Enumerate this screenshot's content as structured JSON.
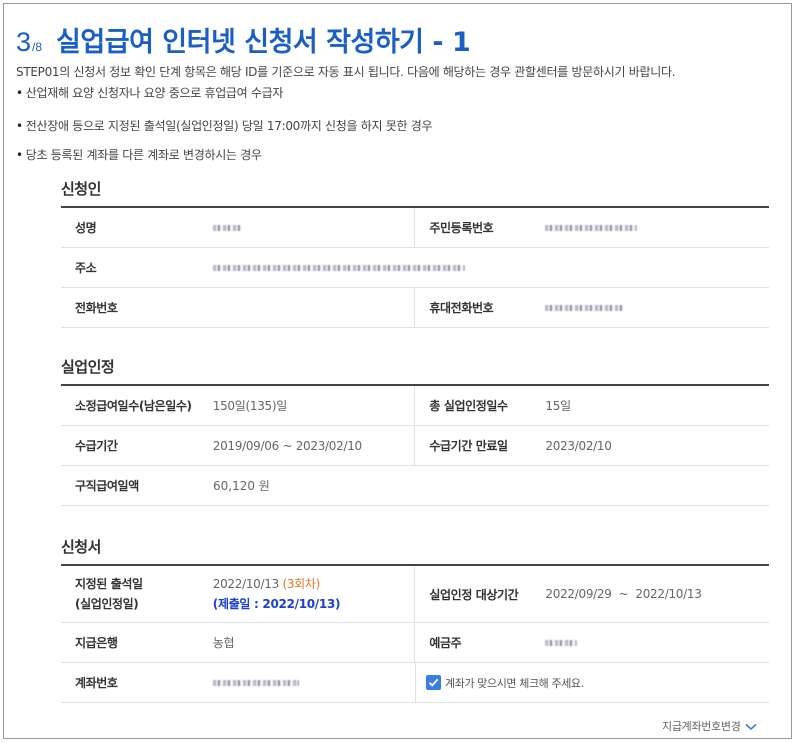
{
  "header": {
    "step_current": "3",
    "step_total": "/8",
    "title": "실업급여 인터넷 신청서 작성하기 - 1"
  },
  "intro": "STEP01의 신청서 정보 확인 단계 항목은 해당 ID를 기준으로 자동 표시 됩니다. 다음에 해당하는 경우 관할센터를 방문하시기 바랍니다.",
  "notes": [
    "산업재해 요양 신청자나 요양 중으로 휴업급여 수급자",
    "전산장애 등으로 지정된 출석일(실업인정일) 당일 17:00까지 신청을 하지 못한 경우",
    "당초 등록된 계좌를 다른 계좌로 변경하시는 경우"
  ],
  "applicant": {
    "section_title": "신청인",
    "name_label": "성명",
    "rrn_label": "주민등록번호",
    "address_label": "주소",
    "phone_label": "전화번호",
    "phone_value": "",
    "mobile_label": "휴대전화번호"
  },
  "unemployment": {
    "section_title": "실업인정",
    "days_label": "소정급여일수(남은일수)",
    "days_value": "150일(135)일",
    "total_days_label": "총 실업인정일수",
    "total_days_value": "15일",
    "period_label": "수급기간",
    "period_value": "2019/09/06 ~ 2023/02/10",
    "expiry_label": "수급기간 만료일",
    "expiry_value": "2023/02/10",
    "daily_label": "구직급여일액",
    "daily_value": "60,120 원"
  },
  "application": {
    "section_title": "신청서",
    "attend_label_1": "지정된 출석일",
    "attend_label_2": "(실업인정일)",
    "attend_date": "2022/10/13",
    "attend_round": "(3회차)",
    "submit_text": "(제출일 : 2022/10/13)",
    "target_period_label": "실업인정 대상기간",
    "target_period_value": "2022/09/29  ~  2022/10/13",
    "bank_label": "지급은행",
    "bank_value": "농협",
    "holder_label": "예금주",
    "account_label": "계좌번호",
    "confirm_label": "계좌가 맞으시면 체크해 주세요.",
    "confirm_checked": true
  },
  "footer": {
    "change_account_label": "지급계좌번호변경"
  },
  "colors": {
    "accent": "#1b5fc4",
    "checkbox": "#3a7fe0",
    "round_orange": "#e0782a",
    "submit_blue": "#1b3fd1"
  },
  "icons": {
    "chevron": "chevron-down-icon",
    "check": "checkmark-icon"
  }
}
